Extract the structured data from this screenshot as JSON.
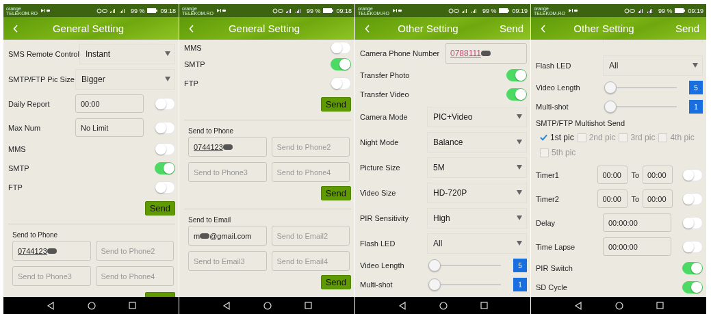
{
  "screens": [
    {
      "status_bar": {
        "carrier": "orange",
        "network": "TELEKOM.RO",
        "battery": "99 %",
        "time": "09:18"
      },
      "header": {
        "title": "General Setting"
      },
      "rows": [
        {
          "kind": "select",
          "label": "SMS Remote Control",
          "value": "Instant"
        },
        {
          "kind": "select",
          "label": "SMTP/FTP Pic Size",
          "value": "Bigger"
        },
        {
          "kind": "field_toggle",
          "label": "Daily Report",
          "value": "00:00",
          "on": false
        },
        {
          "kind": "field_toggle",
          "label": "Max Num",
          "value": "No Limit",
          "on": false
        },
        {
          "kind": "toggle",
          "label": "MMS",
          "on": false
        },
        {
          "kind": "toggle",
          "label": "SMTP",
          "on": true
        },
        {
          "kind": "toggle",
          "label": "FTP",
          "on": false
        },
        {
          "kind": "send",
          "label": "Send"
        },
        {
          "kind": "divider"
        },
        {
          "kind": "section",
          "label": "Send to Phone",
          "fields": [
            {
              "value": "0744123",
              "redacted": true
            },
            {
              "placeholder": "Send to Phone2"
            },
            {
              "placeholder": "Send to Phone3"
            },
            {
              "placeholder": "Send to Phone4"
            }
          ]
        },
        {
          "kind": "send_cut"
        }
      ]
    },
    {
      "status_bar": {
        "carrier": "orange",
        "network": "TELEKOM.RO",
        "battery": "99 %",
        "time": "09:18"
      },
      "header": {
        "title": "General Setting"
      },
      "rows": [
        {
          "kind": "toggle_cut",
          "label": "MMS",
          "on": false
        },
        {
          "kind": "toggle",
          "label": "SMTP",
          "on": true
        },
        {
          "kind": "toggle",
          "label": "FTP",
          "on": false
        },
        {
          "kind": "send",
          "label": "Send"
        },
        {
          "kind": "divider"
        },
        {
          "kind": "section",
          "label": "Send to Phone",
          "fields": [
            {
              "value": "0744123",
              "redacted": true
            },
            {
              "placeholder": "Send to Phone2"
            },
            {
              "placeholder": "Send to Phone3"
            },
            {
              "placeholder": "Send to Phone4"
            }
          ]
        },
        {
          "kind": "send",
          "label": "Send"
        },
        {
          "kind": "divider"
        },
        {
          "kind": "section",
          "label": "Send to Email",
          "fields": [
            {
              "value": "m",
              "redacted": true,
              "value_after": "@gmail.com"
            },
            {
              "placeholder": "Send to Email2"
            },
            {
              "placeholder": "Send to Email3"
            },
            {
              "placeholder": "Send to Email4"
            }
          ]
        },
        {
          "kind": "send",
          "label": "Send"
        }
      ]
    },
    {
      "status_bar": {
        "carrier": "orange",
        "network": "TELEKOM.RO",
        "battery": "99 %",
        "time": "09:19"
      },
      "header": {
        "title": "Other Setting",
        "action": "Send"
      },
      "rows": [
        {
          "kind": "phone_field",
          "label": "Camera Phone Number",
          "value": "0788111",
          "redacted": true
        },
        {
          "kind": "toggle",
          "label": "Transfer Photo",
          "on": true
        },
        {
          "kind": "toggle",
          "label": "Transfer Video",
          "on": true
        },
        {
          "kind": "select",
          "label": "Camera Mode",
          "value": "PIC+Video"
        },
        {
          "kind": "select",
          "label": "Night Mode",
          "value": "Balance"
        },
        {
          "kind": "select",
          "label": "Picture Size",
          "value": "5M"
        },
        {
          "kind": "select",
          "label": "Video Size",
          "value": "HD-720P"
        },
        {
          "kind": "select",
          "label": "PIR Sensitivity",
          "value": "High"
        },
        {
          "kind": "select",
          "label": "Flash LED",
          "value": "All"
        },
        {
          "kind": "slider",
          "label": "Video Length",
          "level": 0,
          "reading": "5"
        },
        {
          "kind": "slider",
          "label": "Multi-shot",
          "level": 0,
          "reading": "1"
        }
      ]
    },
    {
      "status_bar": {
        "carrier": "orange",
        "network": "TELEKOM.RO",
        "battery": "99 %",
        "time": "09:19"
      },
      "header": {
        "title": "Other Setting",
        "action": "Send"
      },
      "rows": [
        {
          "kind": "select_cut"
        },
        {
          "kind": "select",
          "label": "Flash LED",
          "value": "All"
        },
        {
          "kind": "slider",
          "label": "Video Length",
          "level": 0,
          "reading": "5"
        },
        {
          "kind": "slider",
          "label": "Multi-shot",
          "level": 0,
          "reading": "1"
        },
        {
          "kind": "heading",
          "label": "SMTP/FTP Multishot Send"
        },
        {
          "kind": "checks",
          "items": [
            {
              "label": "1st pic",
              "checked": true
            },
            {
              "label": "2nd pic",
              "checked": false
            },
            {
              "label": "3rd pic",
              "checked": false
            },
            {
              "label": "4th pic",
              "checked": false
            },
            {
              "label": "5th pic",
              "checked": false
            }
          ]
        },
        {
          "kind": "timer",
          "label": "Timer1",
          "from": "00:00",
          "to_label": "To",
          "to": "00:00",
          "on": false
        },
        {
          "kind": "timer",
          "label": "Timer2",
          "from": "00:00",
          "to_label": "To",
          "to": "00:00",
          "on": false
        },
        {
          "kind": "field_toggle",
          "label": "Delay",
          "value": "00:00:00",
          "on": false
        },
        {
          "kind": "field_toggle",
          "label": "Time Lapse",
          "value": "00:00:00",
          "on": false
        },
        {
          "kind": "toggle",
          "label": "PIR Switch",
          "on": true
        },
        {
          "kind": "toggle",
          "label": "SD Cycle",
          "on": true
        }
      ]
    }
  ]
}
